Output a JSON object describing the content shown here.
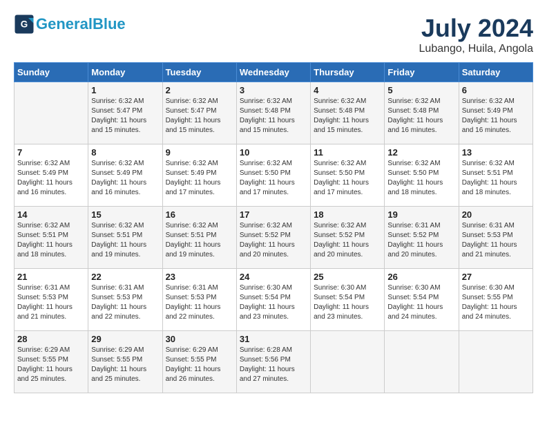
{
  "header": {
    "logo_line1": "General",
    "logo_line2": "Blue",
    "month": "July 2024",
    "location": "Lubango, Huila, Angola"
  },
  "columns": [
    "Sunday",
    "Monday",
    "Tuesday",
    "Wednesday",
    "Thursday",
    "Friday",
    "Saturday"
  ],
  "weeks": [
    [
      {
        "day": "",
        "sunrise": "",
        "sunset": "",
        "daylight": ""
      },
      {
        "day": "1",
        "sunrise": "Sunrise: 6:32 AM",
        "sunset": "Sunset: 5:47 PM",
        "daylight": "Daylight: 11 hours and 15 minutes."
      },
      {
        "day": "2",
        "sunrise": "Sunrise: 6:32 AM",
        "sunset": "Sunset: 5:47 PM",
        "daylight": "Daylight: 11 hours and 15 minutes."
      },
      {
        "day": "3",
        "sunrise": "Sunrise: 6:32 AM",
        "sunset": "Sunset: 5:48 PM",
        "daylight": "Daylight: 11 hours and 15 minutes."
      },
      {
        "day": "4",
        "sunrise": "Sunrise: 6:32 AM",
        "sunset": "Sunset: 5:48 PM",
        "daylight": "Daylight: 11 hours and 15 minutes."
      },
      {
        "day": "5",
        "sunrise": "Sunrise: 6:32 AM",
        "sunset": "Sunset: 5:48 PM",
        "daylight": "Daylight: 11 hours and 16 minutes."
      },
      {
        "day": "6",
        "sunrise": "Sunrise: 6:32 AM",
        "sunset": "Sunset: 5:49 PM",
        "daylight": "Daylight: 11 hours and 16 minutes."
      }
    ],
    [
      {
        "day": "7",
        "sunrise": "Sunrise: 6:32 AM",
        "sunset": "Sunset: 5:49 PM",
        "daylight": "Daylight: 11 hours and 16 minutes."
      },
      {
        "day": "8",
        "sunrise": "Sunrise: 6:32 AM",
        "sunset": "Sunset: 5:49 PM",
        "daylight": "Daylight: 11 hours and 16 minutes."
      },
      {
        "day": "9",
        "sunrise": "Sunrise: 6:32 AM",
        "sunset": "Sunset: 5:49 PM",
        "daylight": "Daylight: 11 hours and 17 minutes."
      },
      {
        "day": "10",
        "sunrise": "Sunrise: 6:32 AM",
        "sunset": "Sunset: 5:50 PM",
        "daylight": "Daylight: 11 hours and 17 minutes."
      },
      {
        "day": "11",
        "sunrise": "Sunrise: 6:32 AM",
        "sunset": "Sunset: 5:50 PM",
        "daylight": "Daylight: 11 hours and 17 minutes."
      },
      {
        "day": "12",
        "sunrise": "Sunrise: 6:32 AM",
        "sunset": "Sunset: 5:50 PM",
        "daylight": "Daylight: 11 hours and 18 minutes."
      },
      {
        "day": "13",
        "sunrise": "Sunrise: 6:32 AM",
        "sunset": "Sunset: 5:51 PM",
        "daylight": "Daylight: 11 hours and 18 minutes."
      }
    ],
    [
      {
        "day": "14",
        "sunrise": "Sunrise: 6:32 AM",
        "sunset": "Sunset: 5:51 PM",
        "daylight": "Daylight: 11 hours and 18 minutes."
      },
      {
        "day": "15",
        "sunrise": "Sunrise: 6:32 AM",
        "sunset": "Sunset: 5:51 PM",
        "daylight": "Daylight: 11 hours and 19 minutes."
      },
      {
        "day": "16",
        "sunrise": "Sunrise: 6:32 AM",
        "sunset": "Sunset: 5:51 PM",
        "daylight": "Daylight: 11 hours and 19 minutes."
      },
      {
        "day": "17",
        "sunrise": "Sunrise: 6:32 AM",
        "sunset": "Sunset: 5:52 PM",
        "daylight": "Daylight: 11 hours and 20 minutes."
      },
      {
        "day": "18",
        "sunrise": "Sunrise: 6:32 AM",
        "sunset": "Sunset: 5:52 PM",
        "daylight": "Daylight: 11 hours and 20 minutes."
      },
      {
        "day": "19",
        "sunrise": "Sunrise: 6:31 AM",
        "sunset": "Sunset: 5:52 PM",
        "daylight": "Daylight: 11 hours and 20 minutes."
      },
      {
        "day": "20",
        "sunrise": "Sunrise: 6:31 AM",
        "sunset": "Sunset: 5:53 PM",
        "daylight": "Daylight: 11 hours and 21 minutes."
      }
    ],
    [
      {
        "day": "21",
        "sunrise": "Sunrise: 6:31 AM",
        "sunset": "Sunset: 5:53 PM",
        "daylight": "Daylight: 11 hours and 21 minutes."
      },
      {
        "day": "22",
        "sunrise": "Sunrise: 6:31 AM",
        "sunset": "Sunset: 5:53 PM",
        "daylight": "Daylight: 11 hours and 22 minutes."
      },
      {
        "day": "23",
        "sunrise": "Sunrise: 6:31 AM",
        "sunset": "Sunset: 5:53 PM",
        "daylight": "Daylight: 11 hours and 22 minutes."
      },
      {
        "day": "24",
        "sunrise": "Sunrise: 6:30 AM",
        "sunset": "Sunset: 5:54 PM",
        "daylight": "Daylight: 11 hours and 23 minutes."
      },
      {
        "day": "25",
        "sunrise": "Sunrise: 6:30 AM",
        "sunset": "Sunset: 5:54 PM",
        "daylight": "Daylight: 11 hours and 23 minutes."
      },
      {
        "day": "26",
        "sunrise": "Sunrise: 6:30 AM",
        "sunset": "Sunset: 5:54 PM",
        "daylight": "Daylight: 11 hours and 24 minutes."
      },
      {
        "day": "27",
        "sunrise": "Sunrise: 6:30 AM",
        "sunset": "Sunset: 5:55 PM",
        "daylight": "Daylight: 11 hours and 24 minutes."
      }
    ],
    [
      {
        "day": "28",
        "sunrise": "Sunrise: 6:29 AM",
        "sunset": "Sunset: 5:55 PM",
        "daylight": "Daylight: 11 hours and 25 minutes."
      },
      {
        "day": "29",
        "sunrise": "Sunrise: 6:29 AM",
        "sunset": "Sunset: 5:55 PM",
        "daylight": "Daylight: 11 hours and 25 minutes."
      },
      {
        "day": "30",
        "sunrise": "Sunrise: 6:29 AM",
        "sunset": "Sunset: 5:55 PM",
        "daylight": "Daylight: 11 hours and 26 minutes."
      },
      {
        "day": "31",
        "sunrise": "Sunrise: 6:28 AM",
        "sunset": "Sunset: 5:56 PM",
        "daylight": "Daylight: 11 hours and 27 minutes."
      },
      {
        "day": "",
        "sunrise": "",
        "sunset": "",
        "daylight": ""
      },
      {
        "day": "",
        "sunrise": "",
        "sunset": "",
        "daylight": ""
      },
      {
        "day": "",
        "sunrise": "",
        "sunset": "",
        "daylight": ""
      }
    ]
  ]
}
